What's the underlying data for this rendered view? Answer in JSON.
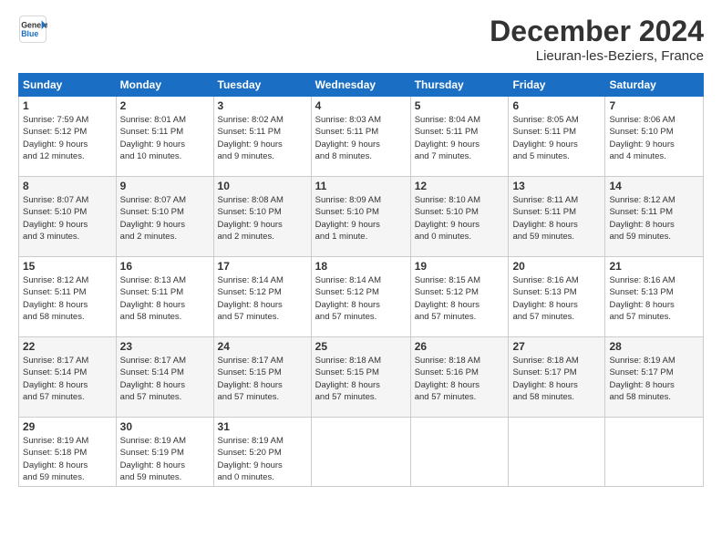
{
  "header": {
    "logo_line1": "General",
    "logo_line2": "Blue",
    "month_title": "December 2024",
    "location": "Lieuran-les-Beziers, France"
  },
  "weekdays": [
    "Sunday",
    "Monday",
    "Tuesday",
    "Wednesday",
    "Thursday",
    "Friday",
    "Saturday"
  ],
  "weeks": [
    [
      {
        "day": "1",
        "info": "Sunrise: 7:59 AM\nSunset: 5:12 PM\nDaylight: 9 hours\nand 12 minutes."
      },
      {
        "day": "2",
        "info": "Sunrise: 8:01 AM\nSunset: 5:11 PM\nDaylight: 9 hours\nand 10 minutes."
      },
      {
        "day": "3",
        "info": "Sunrise: 8:02 AM\nSunset: 5:11 PM\nDaylight: 9 hours\nand 9 minutes."
      },
      {
        "day": "4",
        "info": "Sunrise: 8:03 AM\nSunset: 5:11 PM\nDaylight: 9 hours\nand 8 minutes."
      },
      {
        "day": "5",
        "info": "Sunrise: 8:04 AM\nSunset: 5:11 PM\nDaylight: 9 hours\nand 7 minutes."
      },
      {
        "day": "6",
        "info": "Sunrise: 8:05 AM\nSunset: 5:11 PM\nDaylight: 9 hours\nand 5 minutes."
      },
      {
        "day": "7",
        "info": "Sunrise: 8:06 AM\nSunset: 5:10 PM\nDaylight: 9 hours\nand 4 minutes."
      }
    ],
    [
      {
        "day": "8",
        "info": "Sunrise: 8:07 AM\nSunset: 5:10 PM\nDaylight: 9 hours\nand 3 minutes."
      },
      {
        "day": "9",
        "info": "Sunrise: 8:07 AM\nSunset: 5:10 PM\nDaylight: 9 hours\nand 2 minutes."
      },
      {
        "day": "10",
        "info": "Sunrise: 8:08 AM\nSunset: 5:10 PM\nDaylight: 9 hours\nand 2 minutes."
      },
      {
        "day": "11",
        "info": "Sunrise: 8:09 AM\nSunset: 5:10 PM\nDaylight: 9 hours\nand 1 minute."
      },
      {
        "day": "12",
        "info": "Sunrise: 8:10 AM\nSunset: 5:10 PM\nDaylight: 9 hours\nand 0 minutes."
      },
      {
        "day": "13",
        "info": "Sunrise: 8:11 AM\nSunset: 5:11 PM\nDaylight: 8 hours\nand 59 minutes."
      },
      {
        "day": "14",
        "info": "Sunrise: 8:12 AM\nSunset: 5:11 PM\nDaylight: 8 hours\nand 59 minutes."
      }
    ],
    [
      {
        "day": "15",
        "info": "Sunrise: 8:12 AM\nSunset: 5:11 PM\nDaylight: 8 hours\nand 58 minutes."
      },
      {
        "day": "16",
        "info": "Sunrise: 8:13 AM\nSunset: 5:11 PM\nDaylight: 8 hours\nand 58 minutes."
      },
      {
        "day": "17",
        "info": "Sunrise: 8:14 AM\nSunset: 5:12 PM\nDaylight: 8 hours\nand 57 minutes."
      },
      {
        "day": "18",
        "info": "Sunrise: 8:14 AM\nSunset: 5:12 PM\nDaylight: 8 hours\nand 57 minutes."
      },
      {
        "day": "19",
        "info": "Sunrise: 8:15 AM\nSunset: 5:12 PM\nDaylight: 8 hours\nand 57 minutes."
      },
      {
        "day": "20",
        "info": "Sunrise: 8:16 AM\nSunset: 5:13 PM\nDaylight: 8 hours\nand 57 minutes."
      },
      {
        "day": "21",
        "info": "Sunrise: 8:16 AM\nSunset: 5:13 PM\nDaylight: 8 hours\nand 57 minutes."
      }
    ],
    [
      {
        "day": "22",
        "info": "Sunrise: 8:17 AM\nSunset: 5:14 PM\nDaylight: 8 hours\nand 57 minutes."
      },
      {
        "day": "23",
        "info": "Sunrise: 8:17 AM\nSunset: 5:14 PM\nDaylight: 8 hours\nand 57 minutes."
      },
      {
        "day": "24",
        "info": "Sunrise: 8:17 AM\nSunset: 5:15 PM\nDaylight: 8 hours\nand 57 minutes."
      },
      {
        "day": "25",
        "info": "Sunrise: 8:18 AM\nSunset: 5:15 PM\nDaylight: 8 hours\nand 57 minutes."
      },
      {
        "day": "26",
        "info": "Sunrise: 8:18 AM\nSunset: 5:16 PM\nDaylight: 8 hours\nand 57 minutes."
      },
      {
        "day": "27",
        "info": "Sunrise: 8:18 AM\nSunset: 5:17 PM\nDaylight: 8 hours\nand 58 minutes."
      },
      {
        "day": "28",
        "info": "Sunrise: 8:19 AM\nSunset: 5:17 PM\nDaylight: 8 hours\nand 58 minutes."
      }
    ],
    [
      {
        "day": "29",
        "info": "Sunrise: 8:19 AM\nSunset: 5:18 PM\nDaylight: 8 hours\nand 59 minutes."
      },
      {
        "day": "30",
        "info": "Sunrise: 8:19 AM\nSunset: 5:19 PM\nDaylight: 8 hours\nand 59 minutes."
      },
      {
        "day": "31",
        "info": "Sunrise: 8:19 AM\nSunset: 5:20 PM\nDaylight: 9 hours\nand 0 minutes."
      },
      {
        "day": "",
        "info": ""
      },
      {
        "day": "",
        "info": ""
      },
      {
        "day": "",
        "info": ""
      },
      {
        "day": "",
        "info": ""
      }
    ]
  ]
}
